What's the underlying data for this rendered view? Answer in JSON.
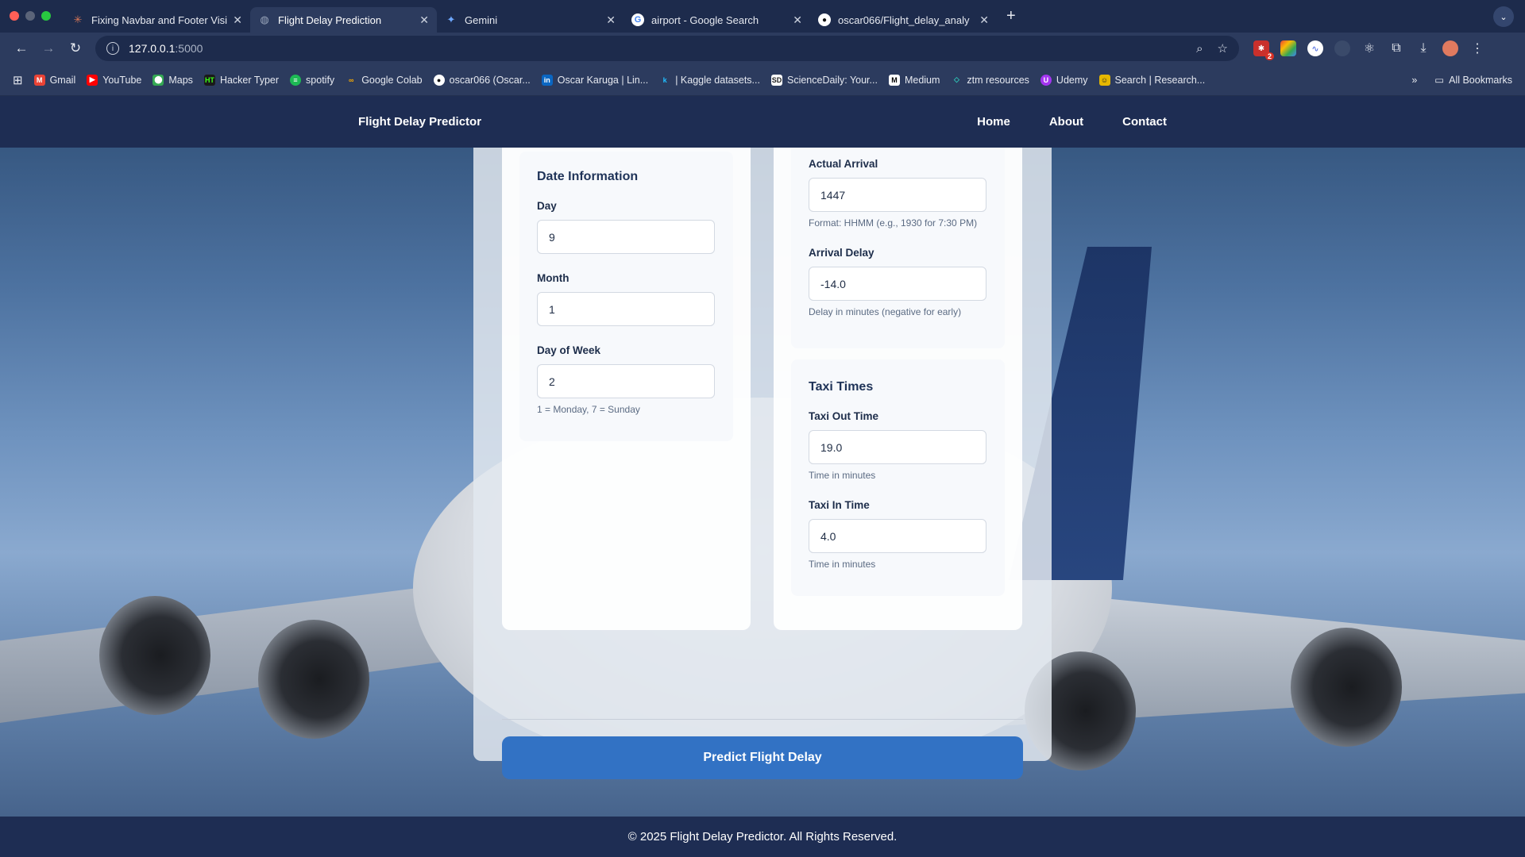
{
  "browser": {
    "tabs": [
      {
        "label": "Fixing Navbar and Footer Visi",
        "icon": "claude-icon",
        "active": false
      },
      {
        "label": "Flight Delay Prediction",
        "icon": "globe-icon",
        "active": true
      },
      {
        "label": "Gemini",
        "icon": "gemini-icon",
        "active": false
      },
      {
        "label": "airport - Google Search",
        "icon": "google-icon",
        "active": false
      },
      {
        "label": "oscar066/Flight_delay_analy",
        "icon": "github-icon",
        "active": false
      }
    ],
    "url_host": "127.0.0.1",
    "url_port": ":5000",
    "extension_badge": "2",
    "bookmarks": [
      {
        "label": "Gmail",
        "icon": "gmail-icon",
        "color": "#ea4335"
      },
      {
        "label": "YouTube",
        "icon": "youtube-icon",
        "color": "#ff0000"
      },
      {
        "label": "Maps",
        "icon": "maps-icon",
        "color": "#34a853"
      },
      {
        "label": "Hacker Typer",
        "icon": "hackertyper-icon",
        "color": "#1a1a1a"
      },
      {
        "label": "spotify",
        "icon": "spotify-icon",
        "color": "#1db954"
      },
      {
        "label": "Google Colab",
        "icon": "colab-icon",
        "color": "#f9ab00"
      },
      {
        "label": "oscar066 (Oscar...",
        "icon": "github-icon",
        "color": "#333333"
      },
      {
        "label": "Oscar Karuga | Lin...",
        "icon": "linkedin-icon",
        "color": "#0a66c2"
      },
      {
        "label": "| Kaggle datasets...",
        "icon": "kaggle-icon",
        "color": "#20beff"
      },
      {
        "label": "ScienceDaily: Your...",
        "icon": "sciencedaily-icon",
        "color": "#444444"
      },
      {
        "label": "Medium",
        "icon": "medium-icon",
        "color": "#000000"
      },
      {
        "label": "ztm resources",
        "icon": "ztm-icon",
        "color": "#2ec4b6"
      },
      {
        "label": "Udemy",
        "icon": "udemy-icon",
        "color": "#a435f0"
      },
      {
        "label": "Search | Research...",
        "icon": "research-icon",
        "color": "#e5b700"
      }
    ],
    "all_bookmarks": "All Bookmarks"
  },
  "site": {
    "brand": "Flight Delay Predictor",
    "nav": [
      "Home",
      "About",
      "Contact"
    ],
    "footer": "© 2025 Flight Delay Predictor. All Rights Reserved."
  },
  "form": {
    "date_section": {
      "title": "Date Information",
      "day_label": "Day",
      "day_value": "9",
      "month_label": "Month",
      "month_value": "1",
      "dow_label": "Day of Week",
      "dow_value": "2",
      "dow_hint": "1 = Monday, 7 = Sunday"
    },
    "arrival_section": {
      "actual_arrival_label": "Actual Arrival",
      "actual_arrival_value": "1447",
      "actual_arrival_hint": "Format: HHMM (e.g., 1930 for 7:30 PM)",
      "arrival_delay_label": "Arrival Delay",
      "arrival_delay_value": "-14.0",
      "arrival_delay_hint": "Delay in minutes (negative for early)"
    },
    "taxi_section": {
      "title": "Taxi Times",
      "taxi_out_label": "Taxi Out Time",
      "taxi_out_value": "19.0",
      "taxi_out_hint": "Time in minutes",
      "taxi_in_label": "Taxi In Time",
      "taxi_in_value": "4.0",
      "taxi_in_hint": "Time in minutes"
    },
    "submit_label": "Predict Flight Delay"
  },
  "colors": {
    "nav_bg": "#1e2d53",
    "button": "#3272c4",
    "heading": "#1f3358"
  }
}
